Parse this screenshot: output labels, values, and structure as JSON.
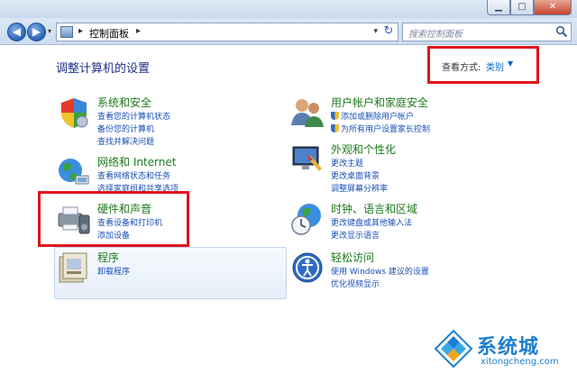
{
  "window": {
    "min_label": "▁",
    "max_label": "□",
    "close_label": "✕"
  },
  "nav": {
    "back_label": "◀",
    "forward_label": "▶",
    "dropdown_label": "▾",
    "address_sep": "▸",
    "address_path": "控制面板",
    "address_sep2": "▸",
    "address_dropdown": "▾",
    "refresh_label": "↻",
    "search_placeholder": "搜索控制面板"
  },
  "content": {
    "title": "调整计算机的设置",
    "view_by_label": "查看方式:",
    "view_by_value": "类别",
    "view_by_arrow": "▼"
  },
  "categories": [
    {
      "icon": "shield-security-icon",
      "title": "系统和安全",
      "links": [
        "查看您的计算机状态",
        "备份您的计算机",
        "查找并解决问题"
      ]
    },
    {
      "icon": "network-globe-icon",
      "title": "网络和 Internet",
      "links": [
        "查看网络状态和任务",
        "选择家庭组和共享选项"
      ]
    },
    {
      "icon": "printer-speaker-icon",
      "title": "硬件和声音",
      "links": [
        "查看设备和打印机",
        "添加设备"
      ]
    },
    {
      "icon": "programs-icon",
      "title": "程序",
      "links": [
        "卸载程序"
      ]
    },
    {
      "icon": "users-icon",
      "title": "用户帐户和家庭安全",
      "links": [
        "添加或删除用户帐户",
        "为所有用户设置家长控制"
      ]
    },
    {
      "icon": "appearance-monitor-icon",
      "title": "外观和个性化",
      "links": [
        "更改主题",
        "更改桌面背景",
        "调整屏幕分辨率"
      ]
    },
    {
      "icon": "clock-globe-icon",
      "title": "时钟、语言和区域",
      "links": [
        "更改键盘或其他输入法",
        "更改显示语言"
      ]
    },
    {
      "icon": "ease-of-access-icon",
      "title": "轻松访问",
      "links": [
        "使用 Windows 建议的设置",
        "优化视频显示"
      ]
    }
  ],
  "watermark": {
    "name": "系统城",
    "url": "xitongcheng.com"
  },
  "colors": {
    "category_title": "#1c7a1c",
    "link": "#1a4fb5",
    "page_title": "#1e3287",
    "highlight_box": "#e0141c"
  }
}
